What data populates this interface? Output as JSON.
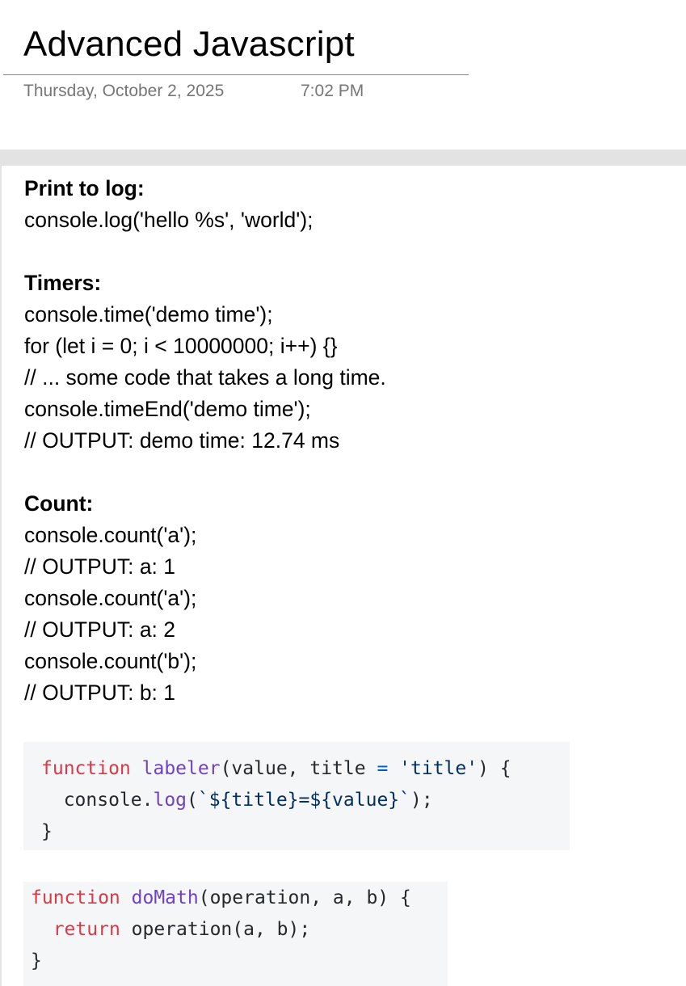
{
  "page": {
    "title": "Advanced Javascript",
    "date": "Thursday, October 2, 2025",
    "time": "7:02 PM"
  },
  "note": {
    "lines": [
      {
        "text": "Print to log:",
        "style": "heading"
      },
      {
        "text": "console.log('hello %s', 'world');",
        "style": "normal"
      },
      {
        "text": "",
        "style": "blank"
      },
      {
        "text": "Timers:",
        "style": "heading"
      },
      {
        "text": "console.time('demo time');",
        "style": "normal"
      },
      {
        "text": "for (let i = 0; i < 10000000; i++) {}",
        "style": "normal"
      },
      {
        "text": "// ... some code that takes a long time.",
        "style": "normal"
      },
      {
        "text": "console.timeEnd('demo time');",
        "style": "normal"
      },
      {
        "text": "// OUTPUT: demo time: 12.74 ms",
        "style": "normal"
      },
      {
        "text": "",
        "style": "blank"
      },
      {
        "text": "Count:",
        "style": "heading"
      },
      {
        "text": "console.count('a');",
        "style": "normal"
      },
      {
        "text": "// OUTPUT: a: 1",
        "style": "normal"
      },
      {
        "text": "console.count('a');",
        "style": "normal"
      },
      {
        "text": "// OUTPUT: a: 2",
        "style": "normal"
      },
      {
        "text": "console.count('b');",
        "style": "normal"
      },
      {
        "text": "// OUTPUT: b: 1",
        "style": "normal"
      }
    ]
  },
  "code_blocks": [
    {
      "lines": [
        [
          {
            "t": "function",
            "k": "keyword"
          },
          {
            "t": " ",
            "k": "plain"
          },
          {
            "t": "labeler",
            "k": "func"
          },
          {
            "t": "(value, title ",
            "k": "plain"
          },
          {
            "t": "=",
            "k": "op"
          },
          {
            "t": " ",
            "k": "plain"
          },
          {
            "t": "'title'",
            "k": "string"
          },
          {
            "t": ") {",
            "k": "plain"
          }
        ],
        [
          {
            "t": "  console.",
            "k": "plain"
          },
          {
            "t": "log",
            "k": "func"
          },
          {
            "t": "(",
            "k": "plain"
          },
          {
            "t": "`${title}=${value}`",
            "k": "string"
          },
          {
            "t": ");",
            "k": "plain"
          }
        ],
        [
          {
            "t": "}",
            "k": "plain"
          }
        ]
      ]
    },
    {
      "lines": [
        [
          {
            "t": "function",
            "k": "keyword"
          },
          {
            "t": " ",
            "k": "plain"
          },
          {
            "t": "doMath",
            "k": "func"
          },
          {
            "t": "(operation, a, b) {",
            "k": "plain"
          }
        ],
        [
          {
            "t": "  ",
            "k": "plain"
          },
          {
            "t": "return",
            "k": "keyword"
          },
          {
            "t": " operation(a, b);",
            "k": "plain"
          }
        ],
        [
          {
            "t": "}",
            "k": "plain"
          }
        ]
      ]
    }
  ],
  "colors": {
    "keyword": "#d73a49",
    "function": "#6f42c1",
    "string": "#032f62",
    "operator": "#005cc5",
    "code_background": "#f5f6f7",
    "meta_text": "#767676"
  }
}
